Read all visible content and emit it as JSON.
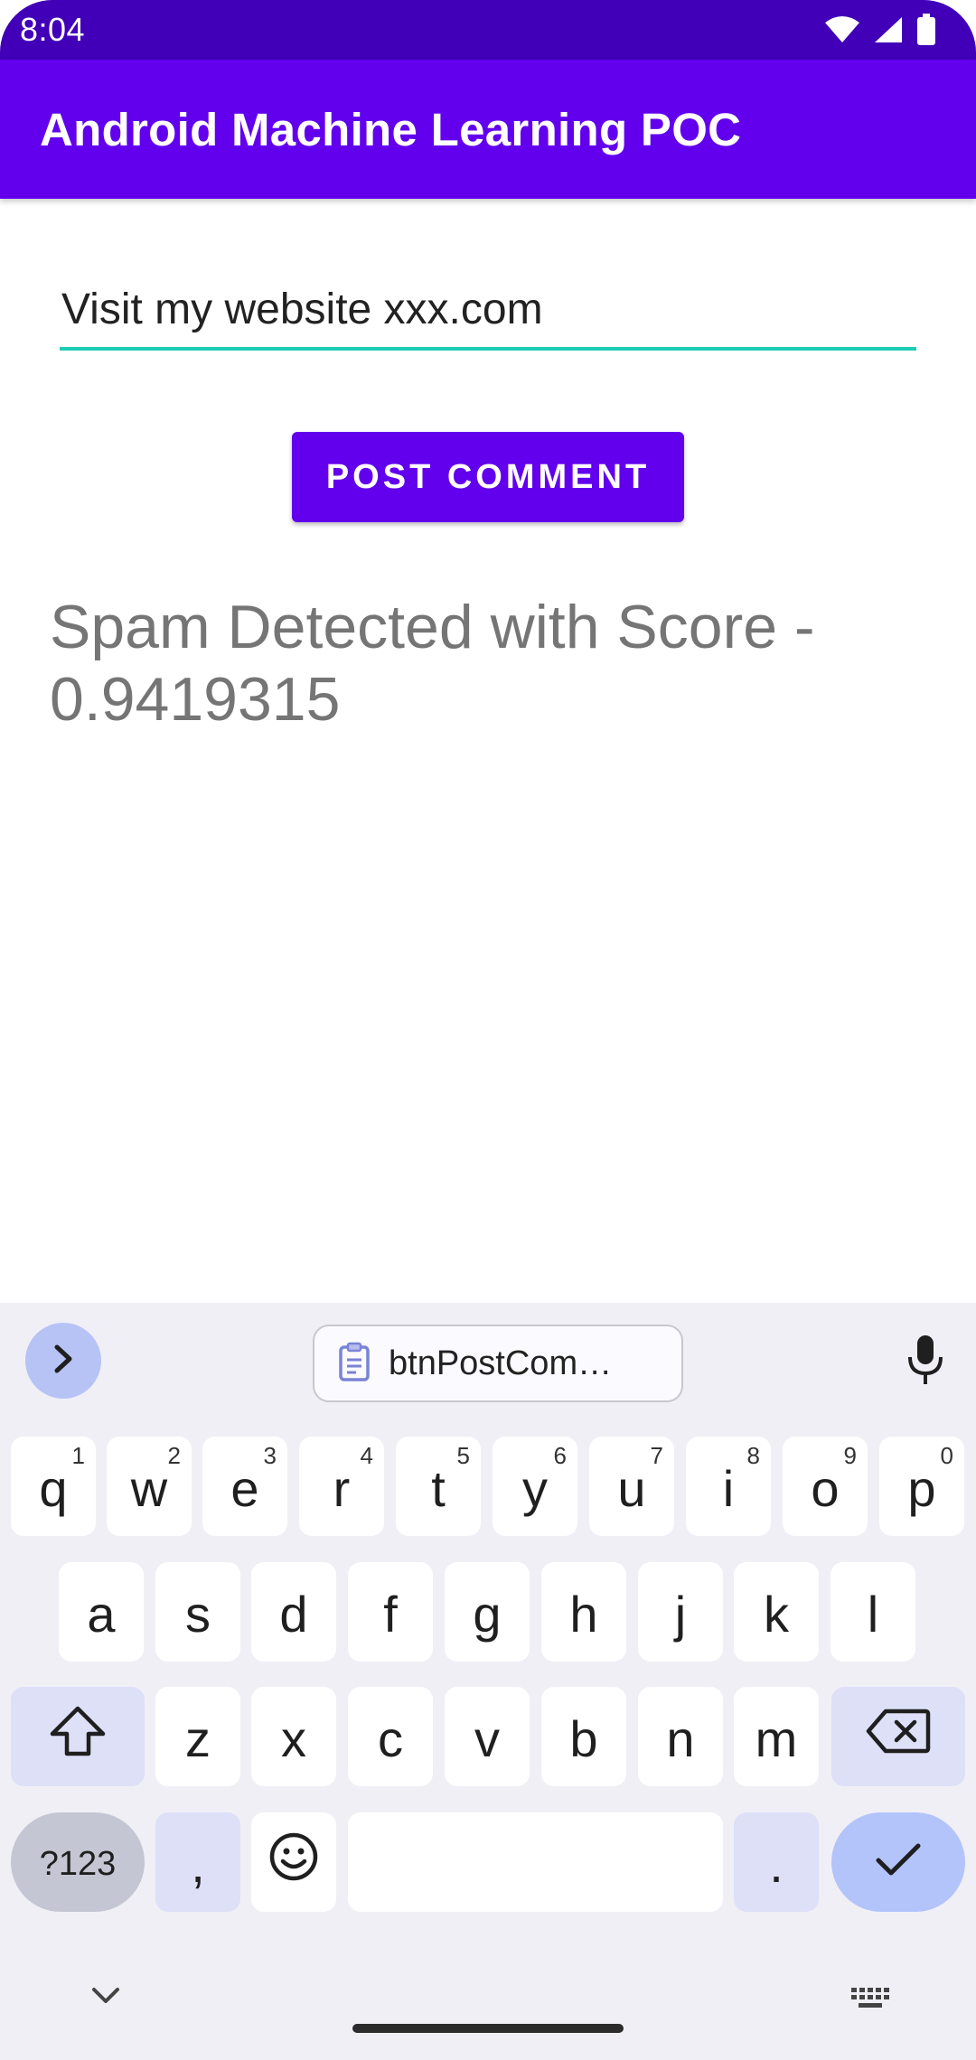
{
  "status_bar": {
    "time": "8:04"
  },
  "app_bar": {
    "title": "Android Machine Learning POC"
  },
  "comment": {
    "value": "Visit my website xxx.com"
  },
  "post_button": {
    "label": "POST COMMENT"
  },
  "result": {
    "text": "Spam Detected with Score - 0.9419315"
  },
  "accent_colors": {
    "app_bar": "#6200ee",
    "status_bar": "#4100b8",
    "input_underline": "#1ccdb4"
  },
  "keyboard": {
    "clipboard_chip": "btnPostCom…",
    "row1": [
      {
        "k": "q",
        "n": "1"
      },
      {
        "k": "w",
        "n": "2"
      },
      {
        "k": "e",
        "n": "3"
      },
      {
        "k": "r",
        "n": "4"
      },
      {
        "k": "t",
        "n": "5"
      },
      {
        "k": "y",
        "n": "6"
      },
      {
        "k": "u",
        "n": "7"
      },
      {
        "k": "i",
        "n": "8"
      },
      {
        "k": "o",
        "n": "9"
      },
      {
        "k": "p",
        "n": "0"
      }
    ],
    "row2": [
      "a",
      "s",
      "d",
      "f",
      "g",
      "h",
      "j",
      "k",
      "l"
    ],
    "row3": [
      "z",
      "x",
      "c",
      "v",
      "b",
      "n",
      "m"
    ],
    "symbols_label": "?123",
    "comma_label": ",",
    "period_label": "."
  },
  "icons": {
    "status": [
      "wifi-icon",
      "signal-icon",
      "battery-icon"
    ],
    "keyboard": [
      "chevron-right-icon",
      "clipboard-icon",
      "microphone-icon",
      "shift-icon",
      "backspace-icon",
      "emoji-icon",
      "checkmark-icon",
      "chevron-down-icon",
      "keyboard-icon"
    ]
  }
}
